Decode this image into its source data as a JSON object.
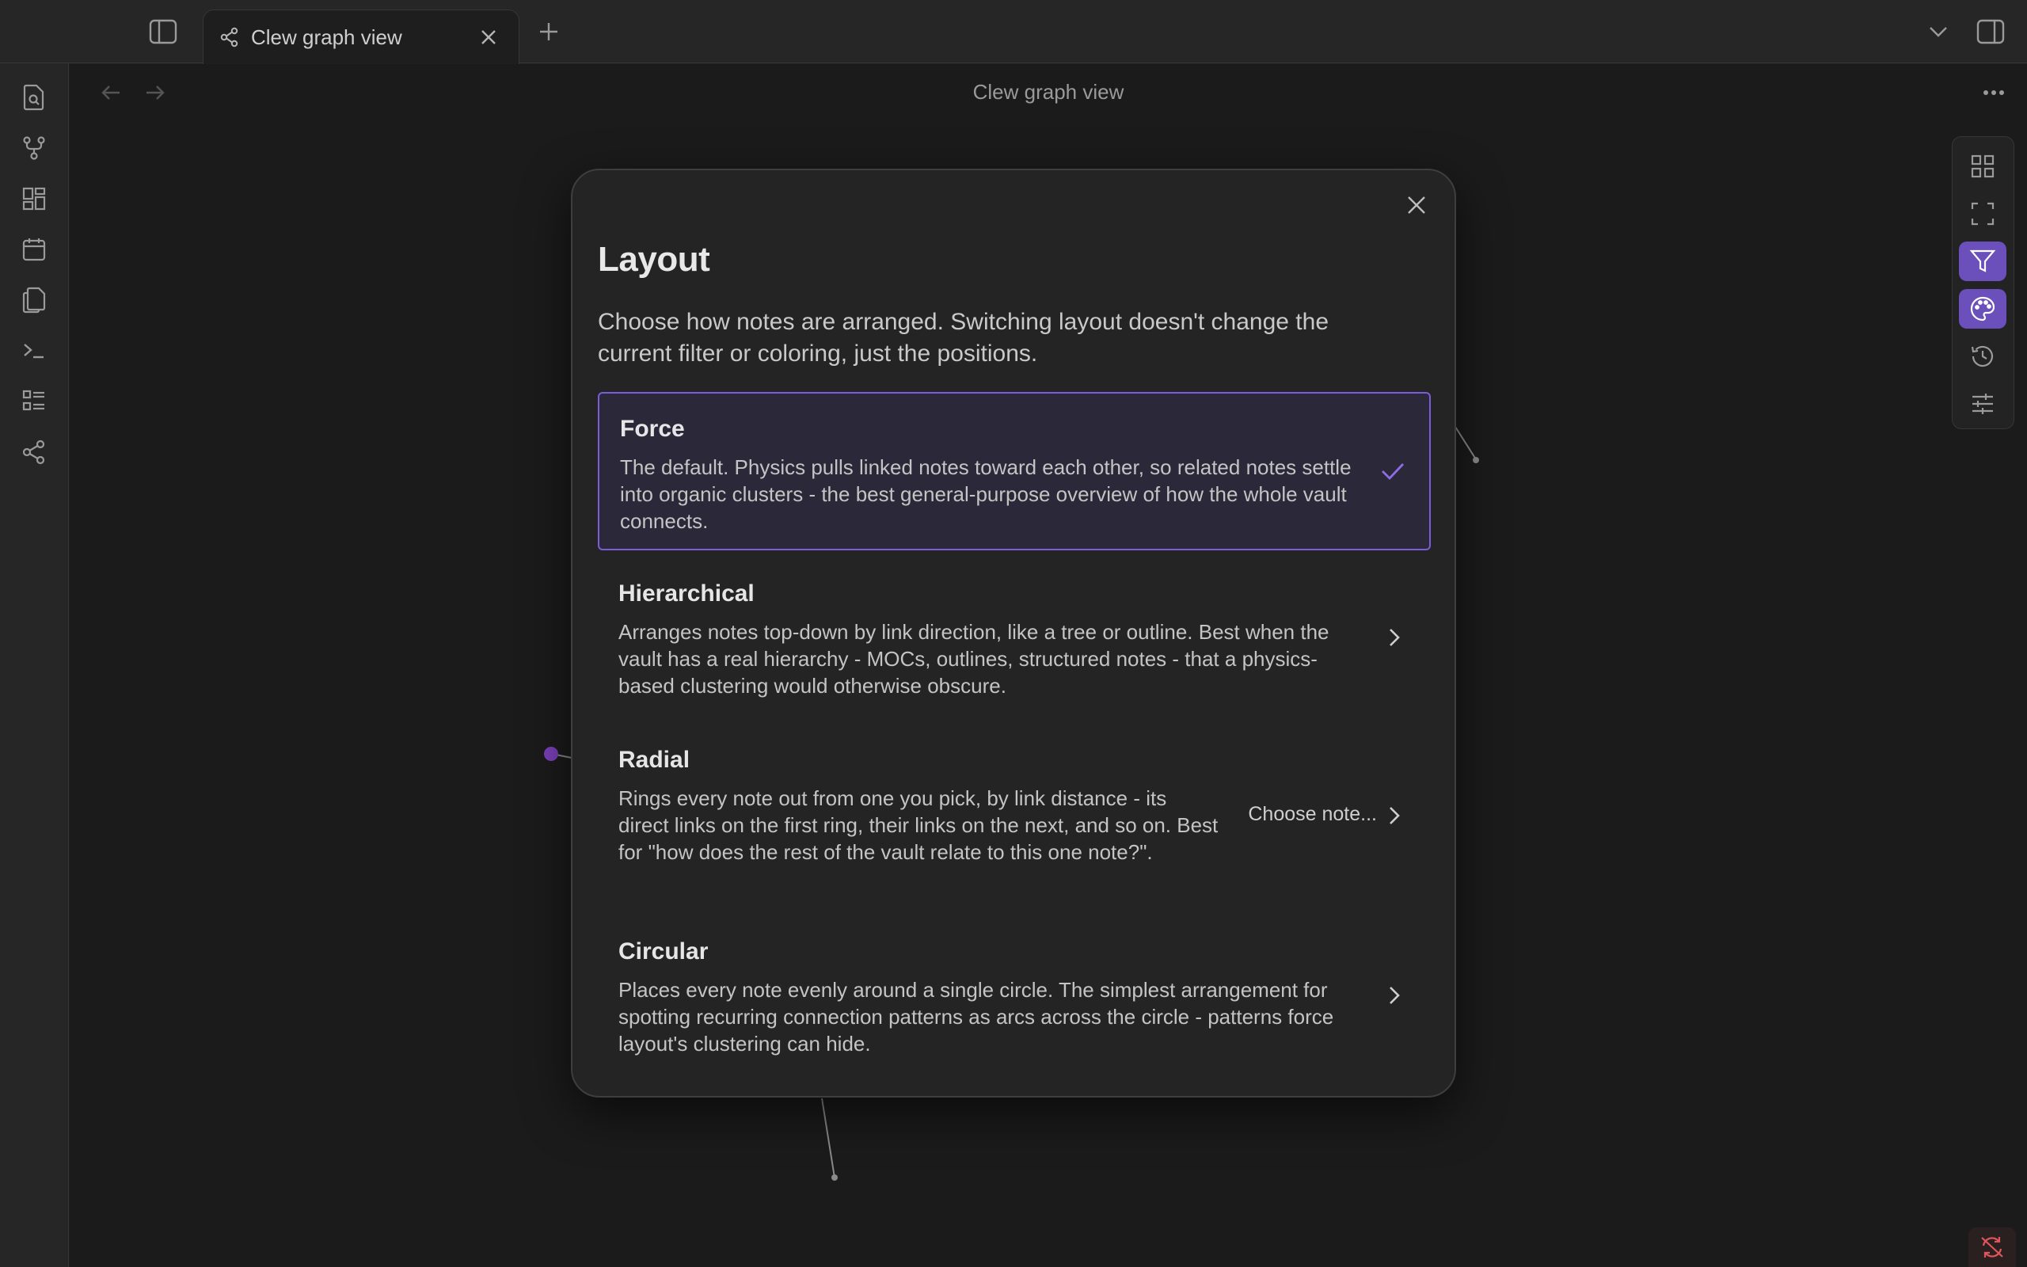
{
  "tab": {
    "title": "Clew graph view"
  },
  "view": {
    "title": "Clew graph view"
  },
  "modal": {
    "title": "Layout",
    "description": "Choose how notes are arranged. Switching layout doesn't change the current filter or coloring, just the positions.",
    "options": [
      {
        "title": "Force",
        "description": "The default. Physics pulls linked notes toward each other, so related notes settle into organic clusters - the best general-purpose overview of how the whole vault connects.",
        "selected": true
      },
      {
        "title": "Hierarchical",
        "description": "Arranges notes top-down by link direction, like a tree or outline. Best when the vault has a real hierarchy - MOCs, outlines, structured notes - that a physics-based clustering would otherwise obscure."
      },
      {
        "title": "Radial",
        "description": "Rings every note out from one you pick, by link distance - its direct links on the first ring, their links on the next, and so on. Best for \"how does the rest of the vault relate to this one note?\".",
        "action_label": "Choose note..."
      },
      {
        "title": "Circular",
        "description": "Places every note evenly around a single circle. The simplest arrangement for spotting recurring connection patterns as arcs across the circle - patterns force layout's clustering can hide."
      }
    ]
  },
  "colors": {
    "accent": "#7c5cd8",
    "active_control": "#6b4fbb",
    "background": "#1e1e1e",
    "sync_warning": "#e0555c"
  },
  "icons": {
    "ribbon": [
      "file-search-icon",
      "git-branch-icon",
      "dashboard-icon",
      "calendar-icon",
      "copy-icon",
      "terminal-icon",
      "list-icon",
      "graph-share-icon"
    ],
    "controls": [
      "grid-icon",
      "fullscreen-icon",
      "filter-icon",
      "palette-icon",
      "history-icon",
      "sliders-icon"
    ]
  }
}
